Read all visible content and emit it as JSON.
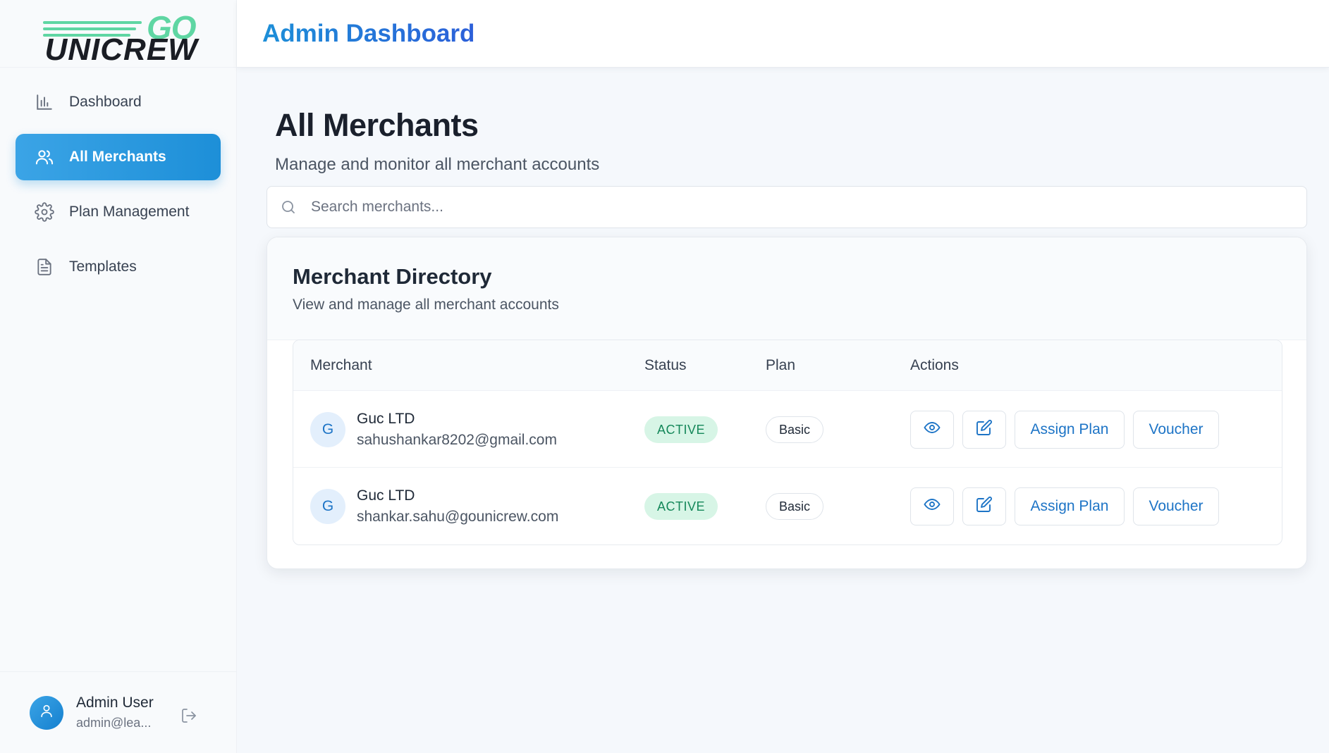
{
  "brand": {
    "logo_top": "GO",
    "logo_bottom": "UNICREW",
    "accent": "#1d8fd8",
    "logo_green": "#5fd6a3"
  },
  "header": {
    "title": "Admin Dashboard"
  },
  "sidebar": {
    "items": [
      {
        "label": "Dashboard",
        "icon": "bar-chart-icon",
        "active": false
      },
      {
        "label": "All Merchants",
        "icon": "users-icon",
        "active": true
      },
      {
        "label": "Plan Management",
        "icon": "gear-icon",
        "active": false
      },
      {
        "label": "Templates",
        "icon": "document-icon",
        "active": false
      }
    ],
    "user": {
      "name": "Admin User",
      "email": "admin@lea..."
    }
  },
  "page": {
    "title": "All Merchants",
    "subtitle": "Manage and monitor all merchant accounts"
  },
  "search": {
    "placeholder": "Search merchants...",
    "value": ""
  },
  "directory": {
    "title": "Merchant Directory",
    "subtitle": "View and manage all merchant accounts",
    "columns": [
      "Merchant",
      "Status",
      "Plan",
      "Actions"
    ],
    "rows": [
      {
        "initial": "G",
        "name": "Guc LTD",
        "email": "sahushankar8202@gmail.com",
        "status": "ACTIVE",
        "plan": "Basic",
        "assign_label": "Assign Plan",
        "voucher_label": "Voucher"
      },
      {
        "initial": "G",
        "name": "Guc LTD",
        "email": "shankar.sahu@gounicrew.com",
        "status": "ACTIVE",
        "plan": "Basic",
        "assign_label": "Assign Plan",
        "voucher_label": "Voucher"
      }
    ]
  }
}
